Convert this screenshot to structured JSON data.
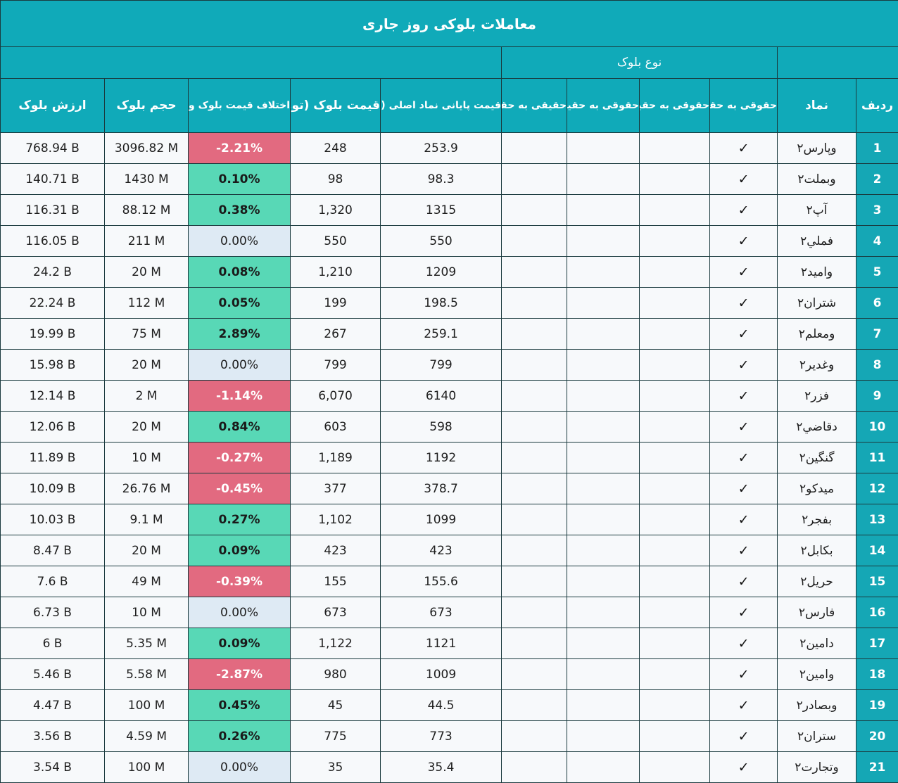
{
  "title": "معاملات بلوکی روز جاری",
  "group_header": "نوع بلوک",
  "headers": {
    "row": "ردیف",
    "symbol": "نماد",
    "type1": "حقوقی به حقوقی",
    "type2": "حقوقی به حقیقی",
    "type3": "حقوقی به حقیقی",
    "type4": "حقیقی به حقوقی",
    "last_price": "قیمت پایانی نماد اصلی (تومان)",
    "block_price": "قیمت بلوک (تومان)",
    "diff": "اختلاف قیمت بلوک و نماد اصلی",
    "volume": "حجم بلوک",
    "value": "ارزش بلوک"
  },
  "check_mark": "✓",
  "colors": {
    "header_bg": "#10aab9",
    "negative": "#e26a80",
    "positive": "#58d8b6",
    "zero": "#deeaf4"
  },
  "rows": [
    {
      "idx": "1",
      "symbol": "وپارس۲",
      "last_price": "253.9",
      "block_price": "248",
      "diff": "-2.21%",
      "volume": "3096.82 M",
      "value": "768.94 B"
    },
    {
      "idx": "2",
      "symbol": "وبملت۲",
      "last_price": "98.3",
      "block_price": "98",
      "diff": "0.10%",
      "volume": "1430 M",
      "value": "140.71 B"
    },
    {
      "idx": "3",
      "symbol": "آپ۲",
      "last_price": "1315",
      "block_price": "1,320",
      "diff": "0.38%",
      "volume": "88.12 M",
      "value": "116.31 B"
    },
    {
      "idx": "4",
      "symbol": "فملي۲",
      "last_price": "550",
      "block_price": "550",
      "diff": "0.00%",
      "volume": "211 M",
      "value": "116.05 B"
    },
    {
      "idx": "5",
      "symbol": "واميد۲",
      "last_price": "1209",
      "block_price": "1,210",
      "diff": "0.08%",
      "volume": "20 M",
      "value": "24.2 B"
    },
    {
      "idx": "6",
      "symbol": "شتران۲",
      "last_price": "198.5",
      "block_price": "199",
      "diff": "0.05%",
      "volume": "112 M",
      "value": "22.24 B"
    },
    {
      "idx": "7",
      "symbol": "ومعلم۲",
      "last_price": "259.1",
      "block_price": "267",
      "diff": "2.89%",
      "volume": "75 M",
      "value": "19.99 B"
    },
    {
      "idx": "8",
      "symbol": "وغدير۲",
      "last_price": "799",
      "block_price": "799",
      "diff": "0.00%",
      "volume": "20 M",
      "value": "15.98 B"
    },
    {
      "idx": "9",
      "symbol": "فزر۲",
      "last_price": "6140",
      "block_price": "6,070",
      "diff": "-1.14%",
      "volume": "2 M",
      "value": "12.14 B"
    },
    {
      "idx": "10",
      "symbol": "دقاضي۲",
      "last_price": "598",
      "block_price": "603",
      "diff": "0.84%",
      "volume": "20 M",
      "value": "12.06 B"
    },
    {
      "idx": "11",
      "symbol": "گنگين۲",
      "last_price": "1192",
      "block_price": "1,189",
      "diff": "-0.27%",
      "volume": "10 M",
      "value": "11.89 B"
    },
    {
      "idx": "12",
      "symbol": "ميدكو۲",
      "last_price": "378.7",
      "block_price": "377",
      "diff": "-0.45%",
      "volume": "26.76 M",
      "value": "10.09 B"
    },
    {
      "idx": "13",
      "symbol": "بفجر۲",
      "last_price": "1099",
      "block_price": "1,102",
      "diff": "0.27%",
      "volume": "9.1 M",
      "value": "10.03 B"
    },
    {
      "idx": "14",
      "symbol": "بكابل۲",
      "last_price": "423",
      "block_price": "423",
      "diff": "0.09%",
      "volume": "20 M",
      "value": "8.47 B"
    },
    {
      "idx": "15",
      "symbol": "حريل۲",
      "last_price": "155.6",
      "block_price": "155",
      "diff": "-0.39%",
      "volume": "49 M",
      "value": "7.6 B"
    },
    {
      "idx": "16",
      "symbol": "فارس۲",
      "last_price": "673",
      "block_price": "673",
      "diff": "0.00%",
      "volume": "10 M",
      "value": "6.73 B"
    },
    {
      "idx": "17",
      "symbol": "دامين۲",
      "last_price": "1121",
      "block_price": "1,122",
      "diff": "0.09%",
      "volume": "5.35 M",
      "value": "6 B"
    },
    {
      "idx": "18",
      "symbol": "وامين۲",
      "last_price": "1009",
      "block_price": "980",
      "diff": "-2.87%",
      "volume": "5.58 M",
      "value": "5.46 B"
    },
    {
      "idx": "19",
      "symbol": "وبصادر۲",
      "last_price": "44.5",
      "block_price": "45",
      "diff": "0.45%",
      "volume": "100 M",
      "value": "4.47 B"
    },
    {
      "idx": "20",
      "symbol": "ستران۲",
      "last_price": "773",
      "block_price": "775",
      "diff": "0.26%",
      "volume": "4.59 M",
      "value": "3.56 B"
    },
    {
      "idx": "21",
      "symbol": "وتجارت۲",
      "last_price": "35.4",
      "block_price": "35",
      "diff": "0.00%",
      "volume": "100 M",
      "value": "3.54 B"
    }
  ]
}
